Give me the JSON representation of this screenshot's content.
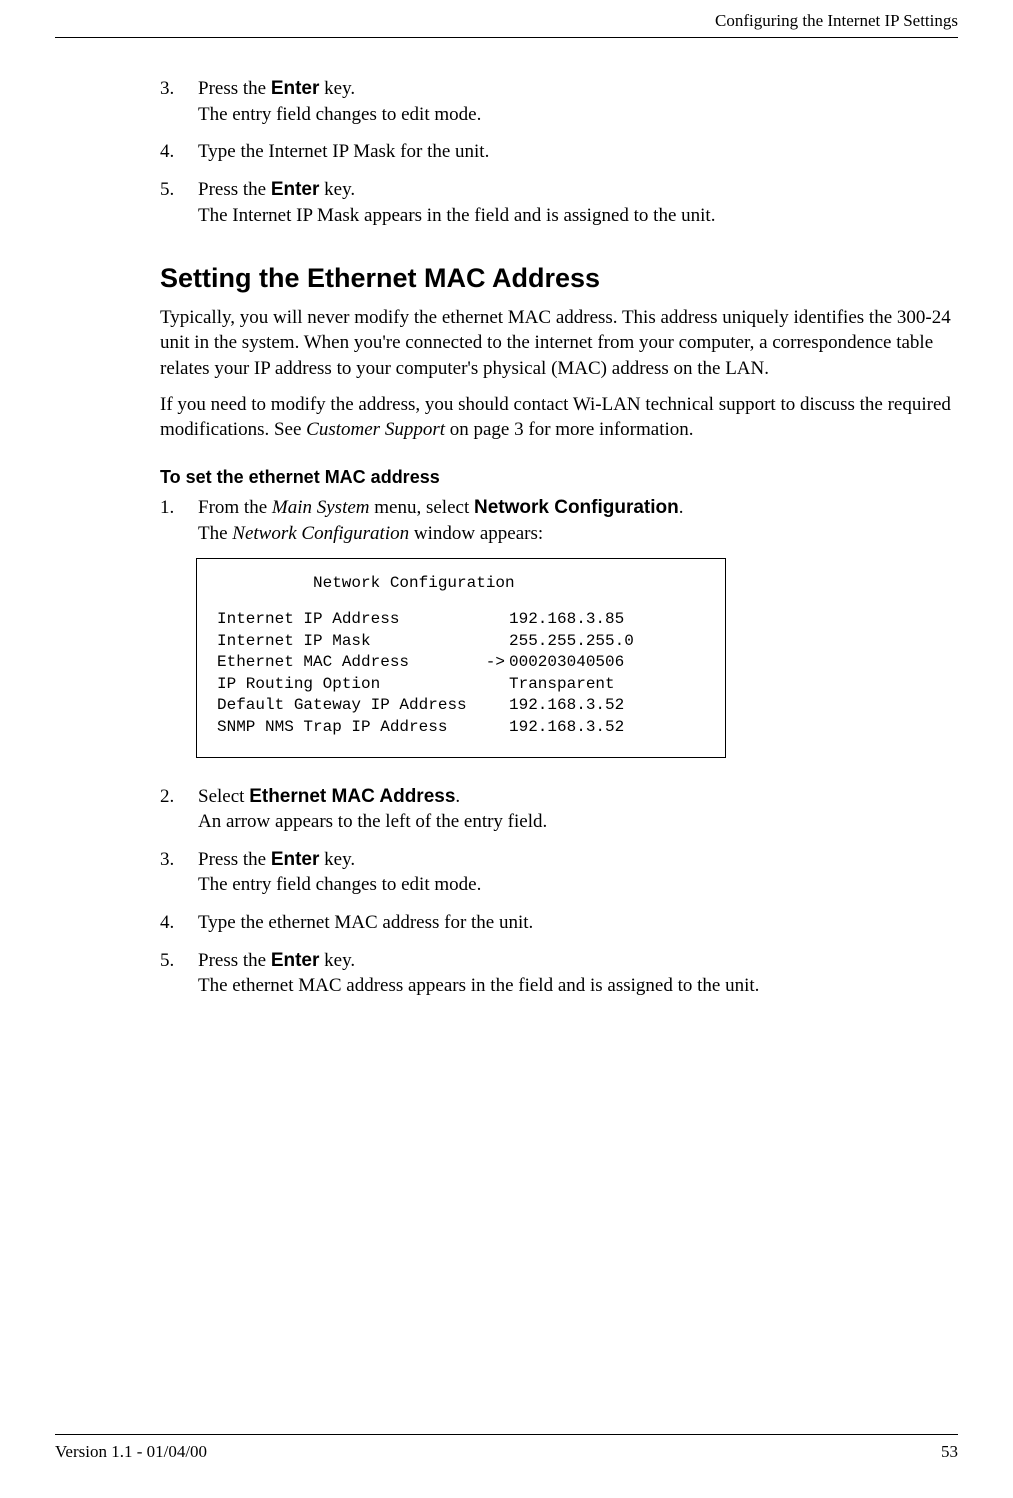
{
  "header": {
    "running_title": "Configuring the Internet IP Settings"
  },
  "top_steps": [
    {
      "n": "3.",
      "line1a": "Press the ",
      "line1b": "Enter",
      "line1c": " key.",
      "line2": "The entry field changes to edit mode."
    },
    {
      "n": "4.",
      "line1a": "Type the Internet IP Mask for the unit.",
      "line1b": "",
      "line1c": "",
      "line2": ""
    },
    {
      "n": "5.",
      "line1a": "Press the ",
      "line1b": "Enter",
      "line1c": " key.",
      "line2": "The Internet IP Mask appears in the field and is assigned to the unit."
    }
  ],
  "section": {
    "title": "Setting the Ethernet MAC Address",
    "para1": "Typically, you will never modify the ethernet MAC address. This address uniquely identifies the 300-24 unit in the system. When you're connected to the internet from your computer, a correspondence table relates your IP address to your computer's physical (MAC) address on the LAN.",
    "para2a": "If you need to modify the address, you should contact Wi-LAN technical support to discuss the required modifications. See ",
    "para2b": "Customer Support",
    "para2c": " on page 3 for more information."
  },
  "subhead": "To set the ethernet MAC address",
  "proc_steps_a": [
    {
      "n": "1.",
      "pre": "From the ",
      "it1": "Main System",
      "mid": " menu, select ",
      "bold": "Network Configuration",
      "post": ".",
      "line2a": "The ",
      "line2b": "Network Configuration",
      "line2c": " window appears:"
    }
  ],
  "config": {
    "title": "Network Configuration",
    "rows": [
      {
        "label": "Internet IP Address",
        "arrow": "",
        "value": "192.168.3.85"
      },
      {
        "label": "Internet IP Mask",
        "arrow": "",
        "value": "255.255.255.0"
      },
      {
        "label": "Ethernet MAC Address",
        "arrow": "->",
        "value": "000203040506"
      },
      {
        "label": "IP Routing Option",
        "arrow": "",
        "value": "Transparent"
      },
      {
        "label": "Default Gateway IP Address",
        "arrow": "",
        "value": "192.168.3.52"
      },
      {
        "label": "SNMP NMS Trap IP Address",
        "arrow": "",
        "value": "192.168.3.52"
      }
    ]
  },
  "proc_steps_b": [
    {
      "n": "2.",
      "pre": "Select ",
      "bold": "Ethernet MAC Address",
      "post": ".",
      "line2": "An arrow appears to the left of the entry field."
    },
    {
      "n": "3.",
      "pre": "Press the ",
      "bold": "Enter",
      "post": " key.",
      "line2": "The entry field changes to edit mode."
    },
    {
      "n": "4.",
      "pre": "Type the ethernet MAC address for the unit.",
      "bold": "",
      "post": "",
      "line2": ""
    },
    {
      "n": "5.",
      "pre": "Press the ",
      "bold": "Enter",
      "post": " key.",
      "line2": "The ethernet MAC address appears in the field and is assigned to the unit."
    }
  ],
  "footer": {
    "left": "Version 1.1 - 01/04/00",
    "right": "53"
  }
}
